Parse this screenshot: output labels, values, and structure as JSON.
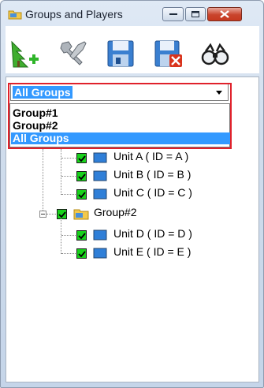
{
  "window": {
    "title": "Groups and Players"
  },
  "toolbar": {
    "tools": [
      {
        "name": "add-player",
        "icon": "tree-add-icon"
      },
      {
        "name": "settings",
        "icon": "wrench-icon"
      },
      {
        "name": "save",
        "icon": "floppy-disk-icon"
      },
      {
        "name": "delete",
        "icon": "floppy-disk-delete-icon"
      },
      {
        "name": "find",
        "icon": "binoculars-icon"
      }
    ]
  },
  "group_select": {
    "value": "All Groups",
    "options": [
      "Group#1",
      "Group#2",
      "All Groups"
    ]
  },
  "tree": {
    "units_group1": [
      "Unit A ( ID = A )",
      "Unit B ( ID = B )",
      "Unit C ( ID = C )"
    ],
    "group2_label": "Group#2",
    "units_group2": [
      "Unit D ( ID = D )",
      "Unit E ( ID = E )"
    ]
  },
  "colors": {
    "selection": "#3399ff",
    "highlight_box": "#e0212b",
    "checkbox": "#18d21c"
  }
}
